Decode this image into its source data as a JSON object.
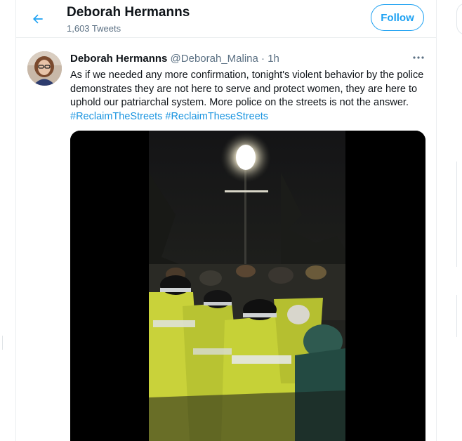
{
  "header": {
    "back_icon": "arrow-left-icon",
    "title": "Deborah Hermanns",
    "subtitle": "1,603 Tweets",
    "follow_label": "Follow"
  },
  "tweet": {
    "author_name": "Deborah Hermanns",
    "author_handle": "@Deborah_Malina",
    "separator": "·",
    "time": "1h",
    "more_icon": "more-horizontal-icon",
    "text": "As if we needed any more confirmation, tonight's violent behavior by the police demonstrates they are not here to serve and protect women, they are here to uphold our patriarchal system. More police on the streets is not the answer.",
    "hashtags": [
      "#ReclaimTheStreets",
      "#ReclaimTheseStreets"
    ]
  },
  "colors": {
    "accent": "#1da1f2",
    "link": "#1b95e0",
    "secondary_text": "#5b7083"
  }
}
